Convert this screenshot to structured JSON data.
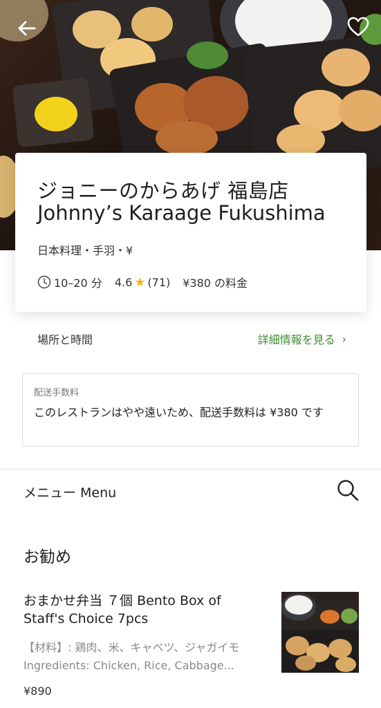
{
  "hero": {
    "image_alt": "",
    "back_icon": "back-arrow-icon",
    "favorite_icon": "heart-icon"
  },
  "restaurant": {
    "name_jp": "ジョニーのからあげ 福島店",
    "name_en": "Johnny’s Karaage Fukushima",
    "cuisine": "日本料理・手羽・¥",
    "delivery_time": "10–20 分",
    "rating": "4.6",
    "rating_count": "(71)",
    "delivery_fee": "¥380 の料金"
  },
  "location": {
    "label": "場所と時間",
    "details_link": "詳細情報を見る"
  },
  "fee_notice": {
    "title": "配送手数料",
    "text": "このレストランはやや遠いため、配送手数料は ¥380 です"
  },
  "menu": {
    "label": "メニュー Menu",
    "section_title": "お勧め",
    "items": [
      {
        "name": "おまかせ弁当 ７個 Bento Box of Staff's Choice 7pcs",
        "description": "【材料】: 鶏肉、米、キャベツ、ジャガイモ Ingredients: Chicken, Rice, Cabbage...",
        "price": "¥890"
      }
    ]
  },
  "colors": {
    "accent_green": "#3d8b2f",
    "star": "#f5b400",
    "text_primary": "#1f1f1f",
    "text_secondary": "#8a8a8a"
  }
}
